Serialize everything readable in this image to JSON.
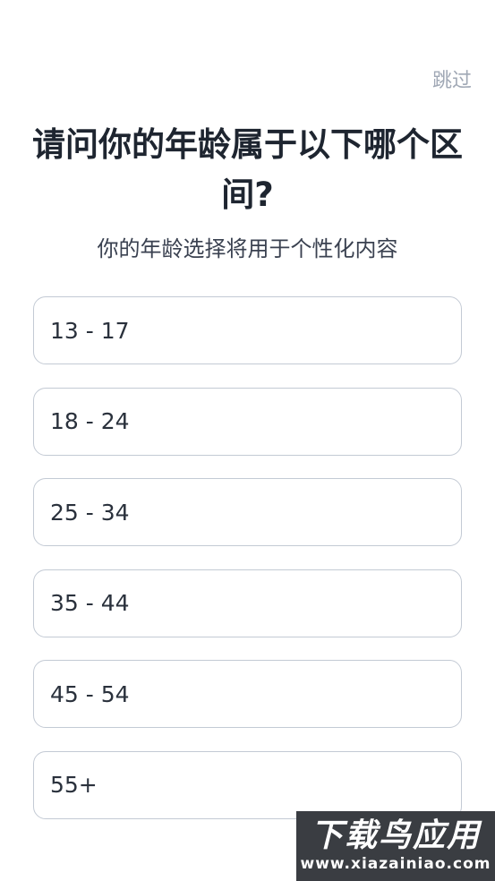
{
  "header": {
    "skip_label": "跳过"
  },
  "question": {
    "title": "请问你的年龄属于以下哪个区间?",
    "subtitle": "你的年龄选择将用于个性化内容"
  },
  "options": [
    {
      "label": "13 - 17"
    },
    {
      "label": "18 - 24"
    },
    {
      "label": "25 - 34"
    },
    {
      "label": "35 - 44"
    },
    {
      "label": "45 - 54"
    },
    {
      "label": "55+"
    }
  ],
  "watermark": {
    "brand": "下载鸟应用",
    "url": "www.xiazainiao.com"
  },
  "colors": {
    "text": "#1e2530",
    "muted": "#a0a8b5",
    "border": "#c3cad4"
  }
}
